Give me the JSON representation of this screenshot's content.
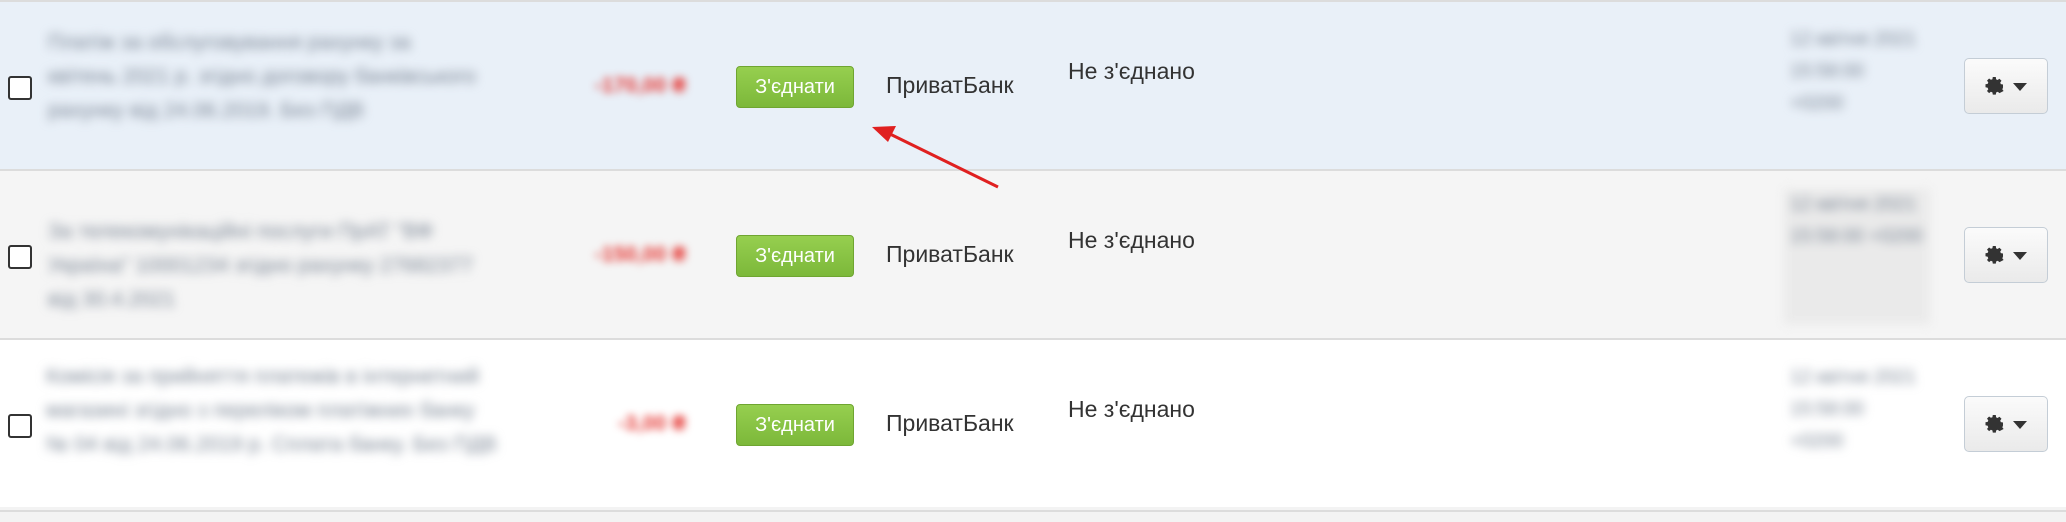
{
  "rows": [
    {
      "description": "Платіж за обслуговування рахунку за квітень 2021 р. згідно договору банківського рахунку від 24.06.2019. Без ПДВ",
      "amount": "-170,00 ₴",
      "connect_label": "З'єднати",
      "bank": "ПриватБанк",
      "status": "Не з'єднано",
      "date": "12 квітня 2021 15:58:00 +0200"
    },
    {
      "description": "За телекомунікаційні послуги ПрАТ \"ВФ Україна\" 10001234 згідно рахунку 27682377 від 30.4.2021",
      "amount": "-150,00 ₴",
      "connect_label": "З'єднати",
      "bank": "ПриватБанк",
      "status": "Не з'єднано",
      "date": "12 квітня 2021 15:58:00 +0200"
    },
    {
      "description": "Комісія за прийняття платежів в інтернетний магазині згідно з переліком платіжних банку № 04 від 24.06.2019 р. Сплата банку. Без ПДВ",
      "amount": "-3,00 ₴",
      "connect_label": "З'єднати",
      "bank": "ПриватБанк",
      "status": "Не з'єднано",
      "date": "12 квітня 2021 15:58:00 +0200"
    }
  ],
  "icons": {
    "settings": "gear-icon",
    "dropdown": "caret-down-icon"
  },
  "colors": {
    "connect_button": "#88c540",
    "amount_negative": "#e53935",
    "annotation_arrow": "#e02020",
    "selected_row_bg": "#e9f0f8"
  }
}
